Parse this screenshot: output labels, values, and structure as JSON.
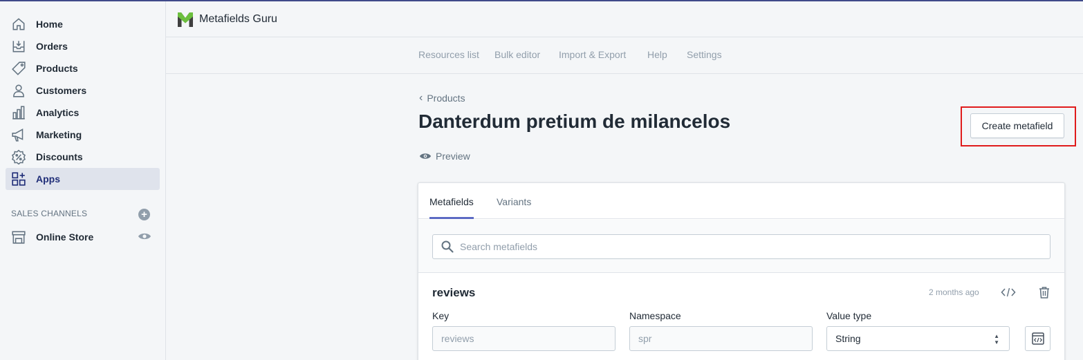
{
  "sidebar": {
    "items": [
      {
        "label": "Home",
        "icon": "home-icon"
      },
      {
        "label": "Orders",
        "icon": "orders-icon"
      },
      {
        "label": "Products",
        "icon": "tag-icon"
      },
      {
        "label": "Customers",
        "icon": "user-icon"
      },
      {
        "label": "Analytics",
        "icon": "bar-chart-icon"
      },
      {
        "label": "Marketing",
        "icon": "megaphone-icon"
      },
      {
        "label": "Discounts",
        "icon": "discount-icon"
      },
      {
        "label": "Apps",
        "icon": "apps-icon",
        "active": true
      }
    ],
    "sales_channels_heading": "SALES CHANNELS",
    "add_channel_symbol": "+",
    "online_store": {
      "label": "Online Store",
      "icon": "store-icon"
    }
  },
  "topbar": {
    "app_name": "Metafields Guru"
  },
  "app_nav": [
    "Resources list",
    "Bulk editor",
    "Import & Export",
    "Help",
    "Settings"
  ],
  "main": {
    "breadcrumb": "Products",
    "title": "Danterdum pretium de milancelos",
    "preview_label": "Preview",
    "create_button": "Create metafield",
    "tabs": [
      "Metafields",
      "Variants"
    ],
    "search_placeholder": "Search metafields",
    "metafield": {
      "name": "reviews",
      "updated": "2 months ago",
      "key_label": "Key",
      "key_value": "reviews",
      "namespace_label": "Namespace",
      "namespace_value": "spr",
      "value_type_label": "Value type",
      "value_type": "String"
    }
  },
  "colors": {
    "accent": "#5c6ac4",
    "highlight": "#e01b1b",
    "active_nav_bg": "#dfe3ec",
    "active_nav_text": "#202e78"
  }
}
